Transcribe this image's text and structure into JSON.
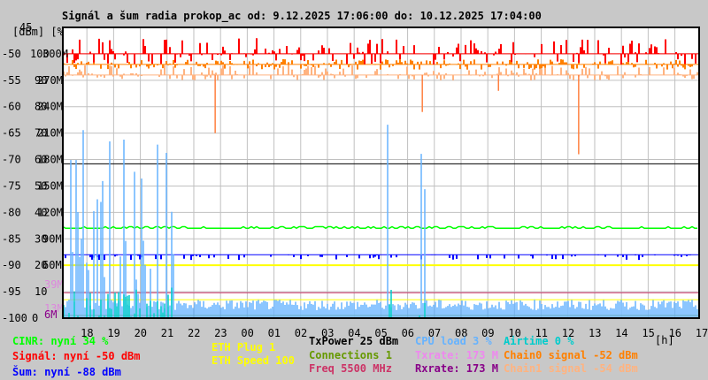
{
  "chart_data": {
    "type": "line",
    "title": "Signál a šum radia prokop_ac od: 9.12.2025 17:06:00 do: 10.12.2025 17:04:00",
    "ylabel": "[dBm] [%]",
    "ylim": [
      -100,
      -45
    ],
    "y_top_label": "45",
    "y_ticks_dbm": [
      "-50",
      "-55",
      "-60",
      "-65",
      "-70",
      "-75",
      "-80",
      "-85",
      "-90",
      "-95",
      "-100"
    ],
    "y_ticks_pct": [
      "100",
      "90",
      "80",
      "70",
      "60",
      "50",
      "40",
      "30",
      "20",
      "10",
      "0"
    ],
    "y_ticks_rate": [
      "300M",
      "270M",
      "240M",
      "210M",
      "180M",
      "150M",
      "120M",
      "90M",
      "60M"
    ],
    "extra_rate_ticks": [
      {
        "label": "39M",
        "color": "#dd88dd"
      },
      {
        "label": "13M",
        "color": "#dd88dd"
      },
      {
        "label": "6M",
        "color": "#880088"
      }
    ],
    "x_ticks": [
      "18",
      "19",
      "20",
      "21",
      "22",
      "23",
      "00",
      "01",
      "02",
      "03",
      "04",
      "05",
      "06",
      "07",
      "08",
      "09",
      "10",
      "11",
      "12",
      "13",
      "14",
      "15",
      "16",
      "17"
    ],
    "xlabel": "[h]",
    "grid": true,
    "x_start_hour": 17.1,
    "series": [
      {
        "name": "Signál",
        "color": "#ff0000",
        "dbm_base": -50,
        "noise_range": [
          -52,
          -47
        ]
      },
      {
        "name": "Chain0 signal",
        "color": "#ff8000",
        "dbm_base": -52,
        "noise_range": [
          -53,
          -51
        ]
      },
      {
        "name": "Chain1 signal",
        "color": "#ffb380",
        "dbm_base": -54,
        "noise_range": [
          -55,
          -52
        ]
      },
      {
        "name": "Šum",
        "color": "#0000ff",
        "dbm_base": -88,
        "noise_range": [
          -89,
          -88
        ]
      },
      {
        "name": "CINR",
        "color": "#00ff00",
        "pct_base": 34
      },
      {
        "name": "CPU load",
        "color": "#66b3ff",
        "pct_base": 3
      },
      {
        "name": "Airtime",
        "color": "#00cccc",
        "pct_base": 0
      }
    ],
    "constant_lines": [
      {
        "name": "TxPower",
        "color": "#000000",
        "y_dbm": -70.8
      },
      {
        "name": "ETH Plug",
        "color": "#ffff00",
        "y_dbm": -90
      },
      {
        "name": "ETH Speed",
        "color": "#ffff00",
        "y_dbm": -96.5
      },
      {
        "name": "Freq",
        "color": "#cc3366",
        "y_dbm": -95.2
      },
      {
        "name": "Connections",
        "color": "#669900",
        "y_dbm": -99.5
      }
    ],
    "dips": [
      {
        "hour": 22.8,
        "dbm": -65
      },
      {
        "hour": 6.55,
        "dbm": -61
      },
      {
        "hour": 12.4,
        "dbm": -69
      },
      {
        "hour": 9.4,
        "dbm": -57
      }
    ]
  },
  "legend": {
    "cinr": "CINR: nyní 34 %",
    "signal": "Signál: nyní -50 dBm",
    "noise": "Šum: nyní -88 dBm",
    "eth_plug": "ETH Plug 1",
    "eth_speed": "ETH Speed 100",
    "txpower": "TxPower 25 dBm",
    "connections": "Connections 1",
    "freq": "Freq 5500 MHz",
    "cpu": "CPU load 3 %",
    "txrate": "Txrate: 173 M",
    "rxrate": "Rxrate: 173 M",
    "airtime": "Airtime 0 %",
    "chain0": "Chain0 signal -52 dBm",
    "chain1": "Chain1 signal -54 dBm"
  }
}
